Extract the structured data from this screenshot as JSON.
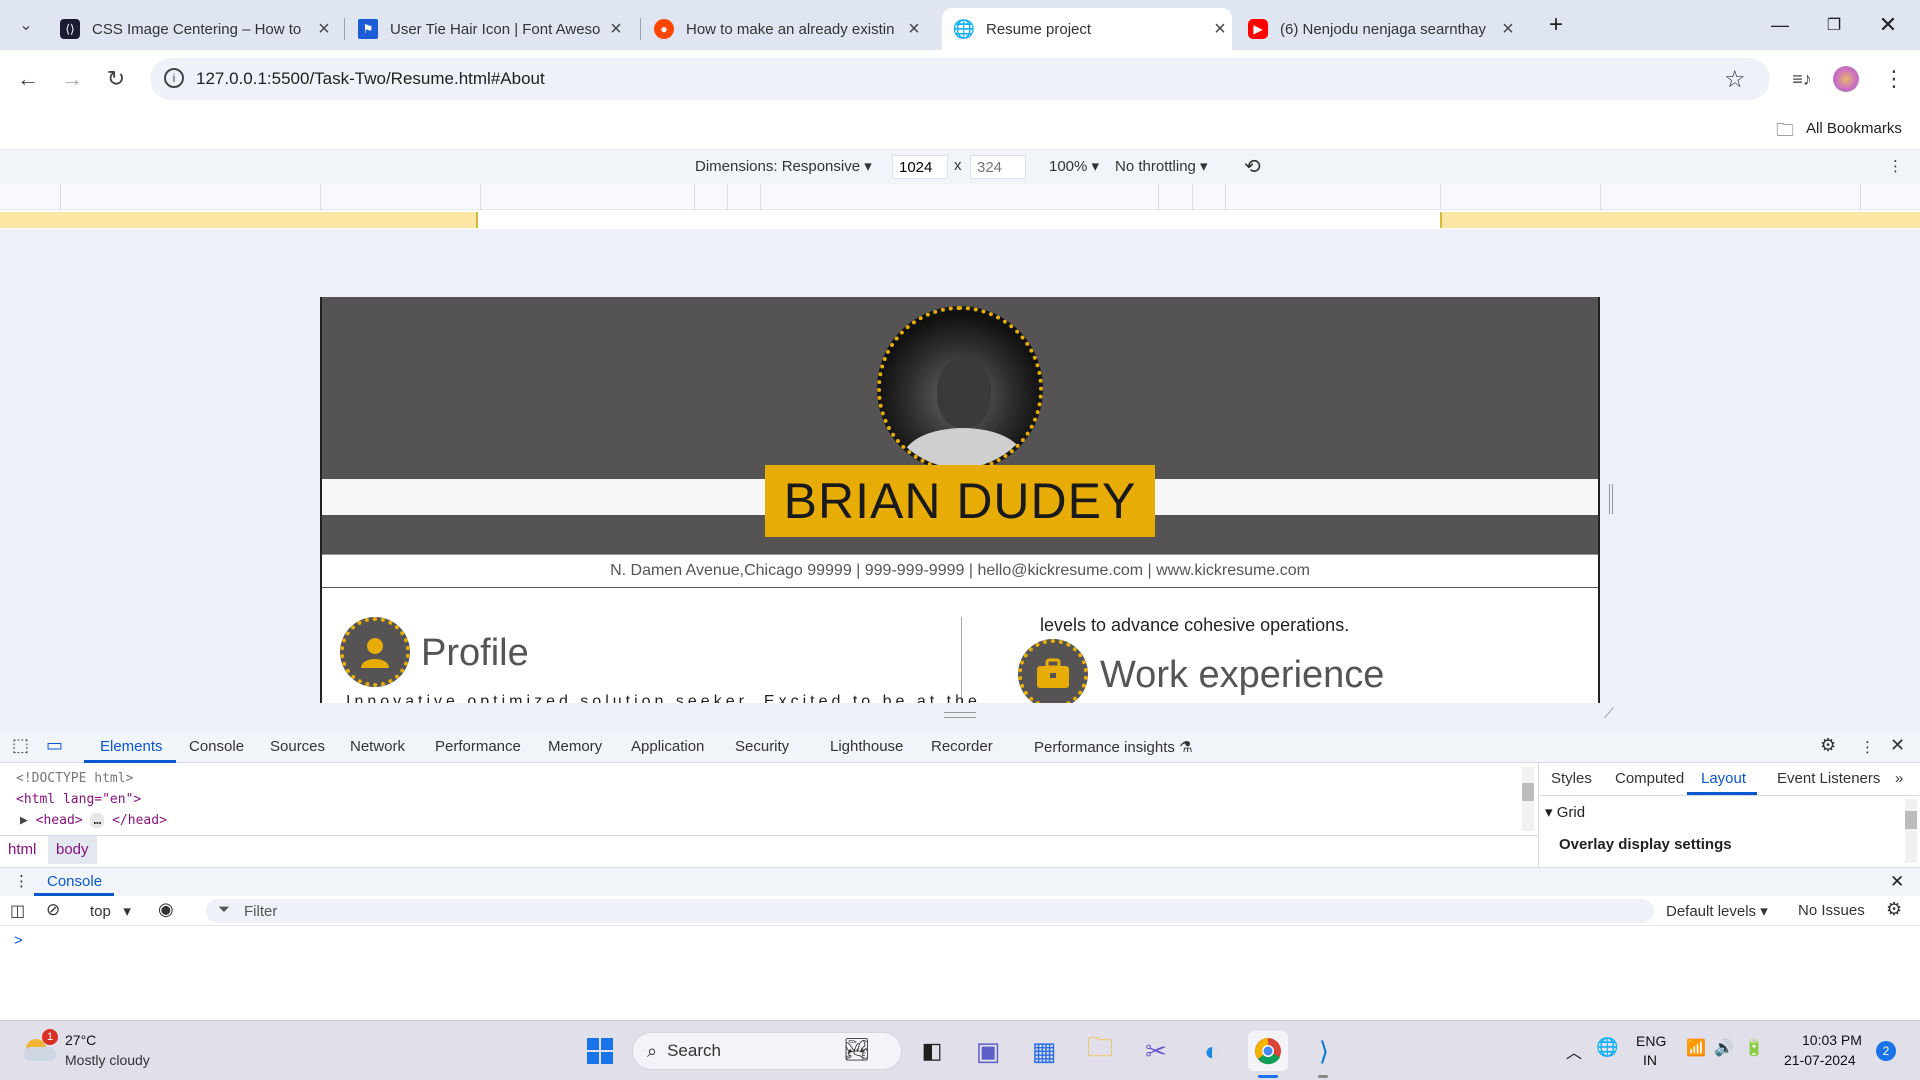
{
  "browser": {
    "tabs": [
      {
        "title": "CSS Image Centering – How to",
        "icon": "freecodecamp-icon",
        "active": false
      },
      {
        "title": "User Tie Hair Icon | Font Aweso",
        "icon": "font-awesome-flag-icon",
        "active": false
      },
      {
        "title": "How to make an already existin",
        "icon": "reddit-icon",
        "active": false
      },
      {
        "title": "Resume project",
        "icon": "globe-icon",
        "active": true
      },
      {
        "title": "(6) Nenjodu nenjaga searnthay",
        "icon": "youtube-icon",
        "active": false
      }
    ],
    "url": "127.0.0.1:5500/Task-Two/Resume.html#About",
    "bookmarks_label": "All Bookmarks"
  },
  "device_toolbar": {
    "dimensions": "Dimensions: Responsive",
    "width": "1024",
    "times": "x",
    "height_placeholder": "324",
    "zoom": "100%",
    "throttling": "No throttling"
  },
  "resume": {
    "name": "BRIAN DUDEY",
    "contact": "N. Damen Avenue,Chicago 99999 | 999-999-9999 | hello@kickresume.com | www.kickresume.com",
    "profile_title": "Profile",
    "profile_text": "Innovative optimized solution seeker. Excited to be at the",
    "experience_line": "levels to advance cohesive operations.",
    "experience_title": "Work experience",
    "colors": {
      "accent": "#e8ac07",
      "header": "#555353"
    }
  },
  "devtools": {
    "tabs": [
      "Elements",
      "Console",
      "Sources",
      "Network",
      "Performance",
      "Memory",
      "Application",
      "Security",
      "Lighthouse",
      "Recorder",
      "Performance insights"
    ],
    "code": {
      "doctype": "<!DOCTYPE html>",
      "html_open": "<html lang=\"en\">",
      "head": "<head>",
      "head_close": "</head>"
    },
    "breadcrumbs": [
      "html",
      "body"
    ],
    "side_tabs": [
      "Styles",
      "Computed",
      "Layout",
      "Event Listeners"
    ],
    "grid_label": "Grid",
    "overlay_label": "Overlay display settings",
    "drawer_tab": "Console",
    "context": "top",
    "filter_placeholder": "Filter",
    "levels": "Default levels",
    "issues": "No Issues",
    "prompt": ">"
  },
  "taskbar": {
    "weather_temp": "27°C",
    "weather_desc": "Mostly cloudy",
    "weather_badge": "1",
    "search_label": "Search",
    "lang": "ENG",
    "region": "IN",
    "time": "10:03 PM",
    "date": "21-07-2024",
    "notif_count": "2"
  }
}
